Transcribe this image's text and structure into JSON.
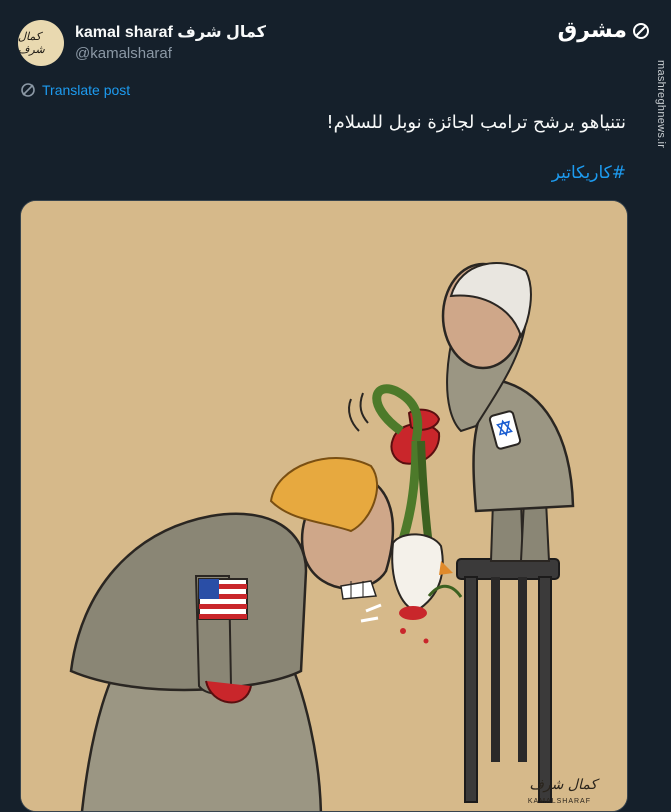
{
  "author": {
    "display_name": "kamal sharaf كمال شرف",
    "handle": "@kamalsharaf",
    "avatar_signature": "كمال شرف"
  },
  "source": {
    "logo_text": "مشرق",
    "url": "mashreghnews.ir"
  },
  "translate": {
    "label": "Translate post",
    "icon": "translate-icon"
  },
  "post": {
    "text": "نتنياهو يرشح ترامب لجائزة نوبل للسلام!",
    "hashtag": "#كاريكاتير"
  },
  "media": {
    "signature": "كمال شرف",
    "signature_latin": "KAMALSHARAF"
  },
  "colors": {
    "background": "#15202b",
    "accent": "#1d9bf0",
    "text": "#f7f9f9",
    "muted": "#8b98a5",
    "cartoon_bg": "#d6b98a"
  }
}
